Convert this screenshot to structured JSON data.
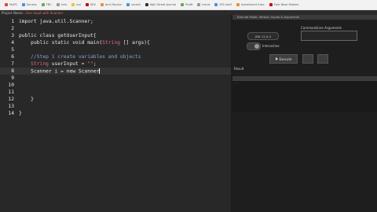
{
  "bookmarks": [
    {
      "label": "MyPS",
      "color": "#e0462f"
    },
    {
      "label": "Zoness",
      "color": "#4a90e2"
    },
    {
      "label": "TBC",
      "color": "#6aa84f"
    },
    {
      "label": "Innk",
      "color": "#999999"
    },
    {
      "label": "aui",
      "color": "#f1c232"
    },
    {
      "label": "SEK",
      "color": "#cc0000"
    },
    {
      "label": "Arch Rockin",
      "color": "#e69138"
    },
    {
      "label": "suresh",
      "color": "#4a90e2"
    },
    {
      "label": "Wall Street Journal",
      "color": "#333333"
    },
    {
      "label": "Profit",
      "color": "#6aa84f"
    },
    {
      "label": "travis",
      "color": "#999999"
    },
    {
      "label": "IOS stuff",
      "color": "#4a90e2"
    },
    {
      "label": "Investment Exec",
      "color": "#e69138"
    },
    {
      "label": "Free Base Makers",
      "color": "#cc0000"
    }
  ],
  "project": {
    "label": "Project Name:",
    "name": "User Input with Scanner"
  },
  "editor": {
    "lines": [
      "1",
      "2",
      "3",
      "4",
      "5",
      "6",
      "7",
      "8",
      "9",
      "10",
      "11",
      "12",
      "13",
      "14"
    ],
    "code": {
      "l1": "import java.util.Scanner;",
      "l3": "public class getUserInput{",
      "l4_a": "    public static void main(",
      "l4_b": "String",
      "l4_c": " [] args){",
      "l6": "    //Step 1 create variables and objects",
      "l7_a": "    ",
      "l7_b": "String",
      "l7_c": " userInput = ",
      "l7_d": "\"\"",
      "l7_e": ";",
      "l8": "    Scanner i = new Scanner",
      "l12": "    }",
      "l14": "}"
    }
  },
  "right_panel": {
    "header": "Execute Mode, Version, Inputs & Arguments",
    "jdk": "JDK 11.0.4",
    "cmd_label": "CommandLine Arguments",
    "interactive_label": "Interactive",
    "execute_label": "Execute",
    "result_label": "Result",
    "result_text": "..."
  }
}
